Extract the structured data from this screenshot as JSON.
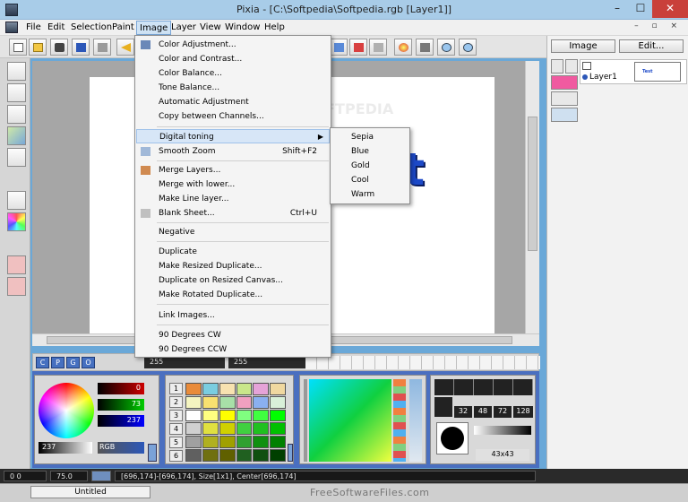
{
  "window": {
    "title": "Pixia - [C:\\Softpedia\\Softpedia.rgb [Layer1]]",
    "min": "–",
    "max": "☐",
    "close": "✕"
  },
  "menubar": {
    "items": [
      "File",
      "Edit",
      "Selection",
      "Paint",
      "Image",
      "Layer",
      "View",
      "Window",
      "Help"
    ],
    "mdi": "– ▫ ×"
  },
  "image_menu": {
    "items": [
      {
        "label": "Color Adjustment..."
      },
      {
        "label": "Color and Contrast..."
      },
      {
        "label": "Color Balance..."
      },
      {
        "label": "Tone Balance..."
      },
      {
        "label": "Automatic Adjustment"
      },
      {
        "label": "Copy between Channels..."
      },
      {
        "label": "Digital toning"
      },
      {
        "label": "Smooth Zoom",
        "shortcut": "Shift+F2"
      },
      {
        "label": "Merge Layers..."
      },
      {
        "label": "Merge with lower..."
      },
      {
        "label": "Make Line layer..."
      },
      {
        "label": "Blank Sheet...",
        "shortcut": "Ctrl+U"
      },
      {
        "label": "Negative"
      },
      {
        "label": "Duplicate"
      },
      {
        "label": "Make Resized Duplicate..."
      },
      {
        "label": "Duplicate on Resized Canvas..."
      },
      {
        "label": "Make Rotated Duplicate..."
      },
      {
        "label": "Link Images..."
      },
      {
        "label": "90 Degrees CW"
      },
      {
        "label": "90 Degrees CCW"
      }
    ]
  },
  "toning_submenu": {
    "items": [
      "Sepia",
      "Blue",
      "Gold",
      "Cool",
      "Warm"
    ]
  },
  "canvas": {
    "text": "Test",
    "watermark": "SOFTPEDIA"
  },
  "layers_panel": {
    "image_tab": "Image",
    "edit_tab": "Edit...",
    "layer_name": "Layer1"
  },
  "color_bar": {
    "c": "C",
    "p": "P",
    "g": "G",
    "o": "O",
    "field1": "255",
    "field2": "255"
  },
  "color_panel": {
    "r": "0",
    "g": "73",
    "b": "237",
    "sat": "237",
    "mode": "RGB"
  },
  "palette": {
    "rows": [
      "1",
      "2",
      "3",
      "4",
      "5",
      "6"
    ]
  },
  "brush_panel": {
    "sizes": [
      "32",
      "48",
      "72",
      "128"
    ],
    "size_value": "43x43"
  },
  "status": {
    "seg1": "0 0",
    "zoom": "75.0",
    "info": "[696,174]-[696,174], Size[1x1], Center[696,174]"
  },
  "tabs": {
    "doc": "Untitled"
  },
  "footer_watermark": "FreeSoftwareFiles.com"
}
